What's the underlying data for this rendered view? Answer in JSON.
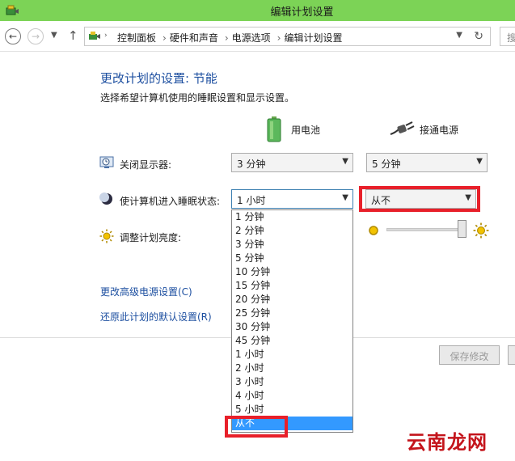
{
  "window": {
    "title": "编辑计划设置"
  },
  "nav": {
    "breadcrumbs": [
      "控制面板",
      "硬件和声音",
      "电源选项",
      "编辑计划设置"
    ],
    "search_placeholder": "搜"
  },
  "page": {
    "heading": "更改计划的设置: 节能",
    "subtitle": "选择希望计算机使用的睡眠设置和显示设置。"
  },
  "columns": {
    "battery": "用电池",
    "plugged": "接通电源"
  },
  "settings": {
    "display": {
      "label": "关闭显示器:",
      "battery_value": "3 分钟",
      "plugged_value": "5 分钟"
    },
    "sleep": {
      "label": "使计算机进入睡眠状态:",
      "battery_value": "1 小时",
      "plugged_value": "从不"
    },
    "brightness": {
      "label": "调整计划亮度:",
      "plugged_level_percent": 100
    }
  },
  "links": {
    "advanced": "更改高级电源设置(C)",
    "restore": "还原此计划的默认设置(R)"
  },
  "buttons": {
    "save": "保存修改"
  },
  "dropdown": {
    "options": [
      "1 分钟",
      "2 分钟",
      "3 分钟",
      "5 分钟",
      "10 分钟",
      "15 分钟",
      "20 分钟",
      "25 分钟",
      "30 分钟",
      "45 分钟",
      "1 小时",
      "2 小时",
      "3 小时",
      "4 小时",
      "5 小时",
      "从不"
    ],
    "highlighted": "从不"
  },
  "watermark": "云南龙网",
  "colors": {
    "titlebar": "#7cd356",
    "link": "#1d4fa0",
    "highlight": "#3399ff",
    "annotation_red": "#e8202a"
  }
}
